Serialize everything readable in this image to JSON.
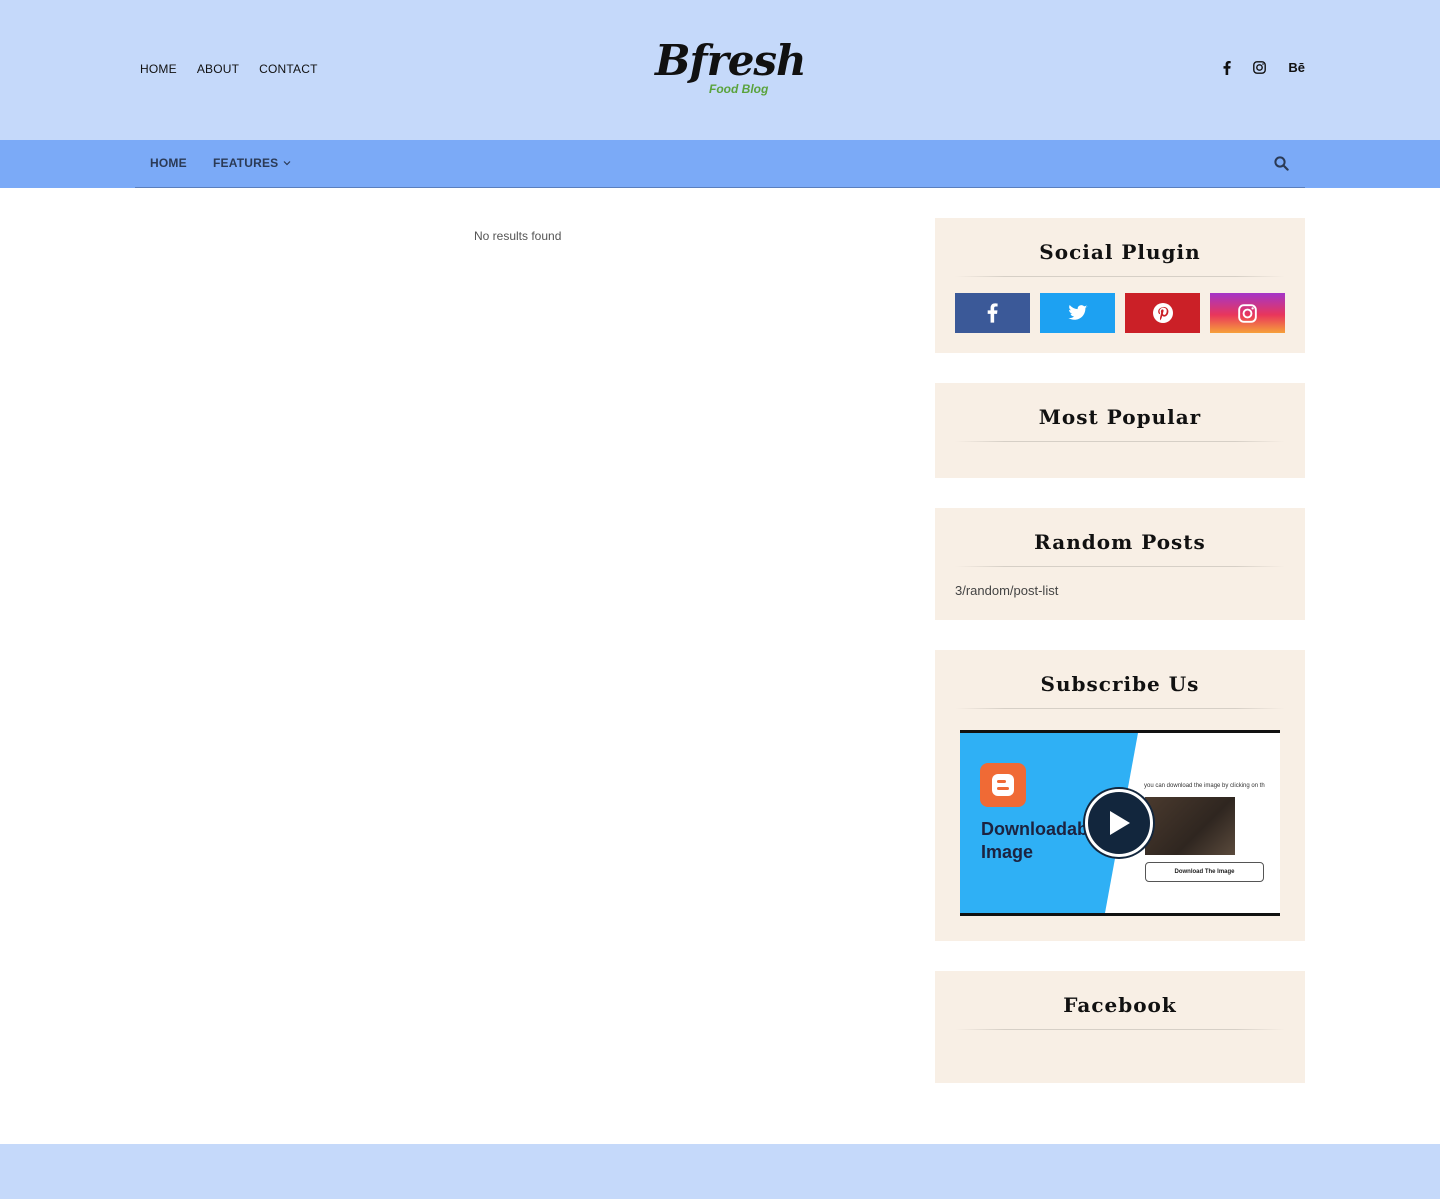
{
  "header": {
    "top_links": [
      "HOME",
      "ABOUT",
      "CONTACT"
    ],
    "logo_main": "Bfresh",
    "logo_sub": "Food Blog",
    "social_icons": [
      "facebook-icon",
      "instagram-icon",
      "behance-icon"
    ],
    "behance_text": "Bē"
  },
  "nav": {
    "home_label": "HOME",
    "features_label": "FEATURES",
    "search_icon": "search-icon"
  },
  "main": {
    "no_results": "No results found"
  },
  "sidebar": {
    "social_plugin": {
      "title": "Social Plugin",
      "buttons": [
        {
          "icon": "facebook-icon",
          "color": "#3b5998"
        },
        {
          "icon": "twitter-icon",
          "color": "#1da1f2"
        },
        {
          "icon": "pinterest-icon",
          "color": "#cb2027"
        },
        {
          "icon": "instagram-icon",
          "color": "#e9365b"
        }
      ]
    },
    "most_popular": {
      "title": "Most Popular"
    },
    "random_posts": {
      "title": "Random Posts",
      "content": "3/random/post-list"
    },
    "subscribe": {
      "title": "Subscribe Us",
      "video": {
        "title_line1": "Downloadable",
        "title_line2": "Image",
        "caption": "you can download the image by clicking on th",
        "button_label": "Download The Image"
      }
    },
    "facebook": {
      "title": "Facebook"
    }
  },
  "colors": {
    "header_bg": "#c5d9fa",
    "nav_bg": "#7baaf7",
    "widget_bg": "#f8efe5",
    "logo_sub": "#5aa33c",
    "video_blue": "#2fb0f5"
  }
}
